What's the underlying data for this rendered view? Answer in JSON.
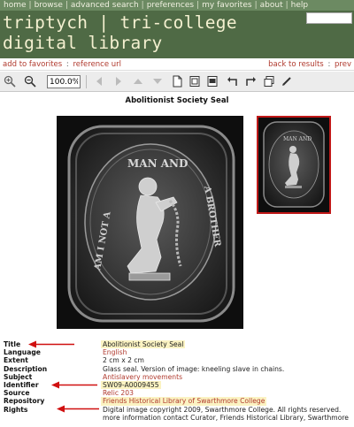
{
  "topnav": {
    "items": [
      "home",
      "browse",
      "advanced search",
      "preferences",
      "my favorites",
      "about",
      "help"
    ]
  },
  "site_title": "triptych | tri-college digital library",
  "actions": {
    "add_to_favorites": "add to favorites",
    "reference_url": "reference url",
    "back_to_results": "back to results",
    "prev": "prev",
    "sep": ":"
  },
  "toolbar": {
    "zoom_value": "100.0%"
  },
  "image_title": "Abolitionist Society Seal",
  "seal": {
    "top_text": "MAN AND",
    "left_text": "AM I NOT A",
    "right_text": "A BROTHER"
  },
  "metadata": [
    {
      "label": "Title",
      "value": "Abolitionist Society Seal",
      "style": "hl"
    },
    {
      "label": "Language",
      "value": "English",
      "style": "link"
    },
    {
      "label": "Extent",
      "value": "2 cm x 2 cm",
      "style": ""
    },
    {
      "label": "Description",
      "value": "Glass seal. Version of image: kneeling slave in chains.",
      "style": ""
    },
    {
      "label": "Subject",
      "value": "Antislavery movements",
      "style": "link"
    },
    {
      "label": "Identifier",
      "value": "SW09-A0009455",
      "style": "hl"
    },
    {
      "label": "Source",
      "value": "Relic 203",
      "style": "link"
    },
    {
      "label": "Repository",
      "value": "Friends Historical Library of Swarthmore College",
      "style": "hl"
    },
    {
      "label": "Rights",
      "value": "Digital image copyright 2009, Swarthmore College. All rights reserved.",
      "style": ""
    },
    {
      "label": "",
      "value": "more information contact Curator, Friends Historical Library, Swarthmore",
      "style": ""
    }
  ],
  "colors": {
    "header_bg": "#4f6a45",
    "link": "#b03a2e",
    "highlight": "#fbf3c2",
    "arrow": "#d01010"
  }
}
